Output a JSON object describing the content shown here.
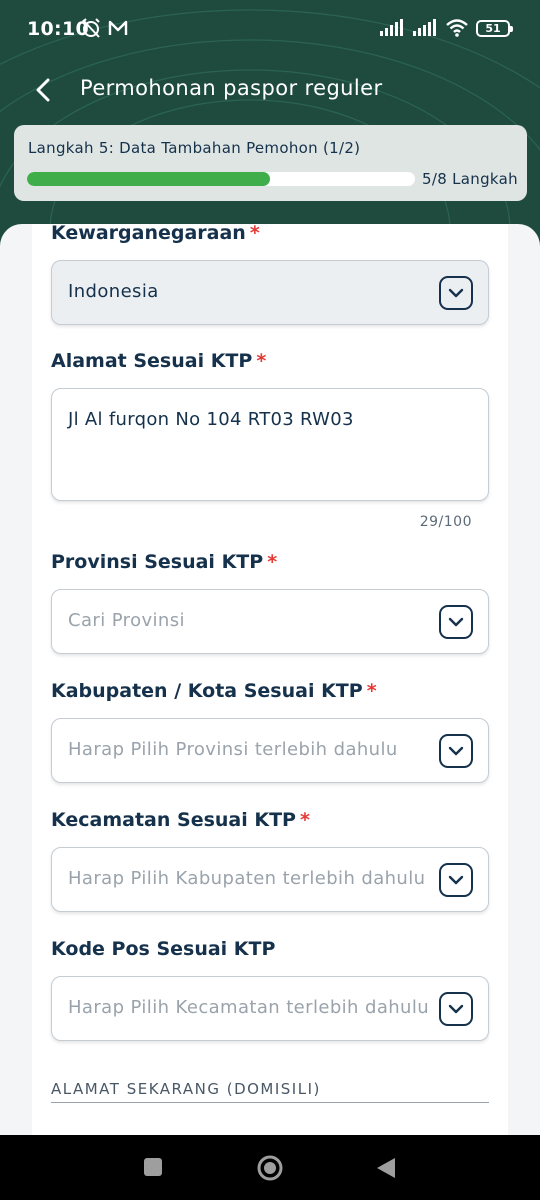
{
  "status_bar": {
    "time": "10:10",
    "battery": "51"
  },
  "app_bar": {
    "title": "Permohonan paspor reguler"
  },
  "progress": {
    "step_label": "Langkah 5: Data Tambahan Pemohon (1/2)",
    "steps_text": "5/8 Langkah",
    "fraction": 0.625
  },
  "form": {
    "kewarganegaraan": {
      "label": "Kewarganegaraan",
      "required_mark": "*",
      "value": "Indonesia"
    },
    "alamat_ktp": {
      "label": "Alamat Sesuai KTP",
      "required_mark": "*",
      "value": "Jl Al furqon No 104 RT03 RW03",
      "counter": "29/100"
    },
    "provinsi": {
      "label": "Provinsi Sesuai KTP",
      "required_mark": "*",
      "placeholder": "Cari Provinsi"
    },
    "kabupaten": {
      "label": "Kabupaten / Kota Sesuai KTP",
      "required_mark": "*",
      "placeholder": "Harap Pilih Provinsi terlebih dahulu"
    },
    "kecamatan": {
      "label": "Kecamatan Sesuai KTP",
      "required_mark": "*",
      "placeholder": "Harap Pilih Kabupaten terlebih dahulu"
    },
    "kode_pos": {
      "label": "Kode Pos Sesuai KTP",
      "placeholder": "Harap Pilih Kecamatan terlebih dahulu"
    },
    "section_domisili": "ALAMAT SEKARANG (DOMISILI)"
  },
  "colors": {
    "header": "#1f4b3f",
    "progress_fill": "#3fae4a",
    "text_primary": "#15314b",
    "required": "#e53935",
    "placeholder": "#9aa3ab"
  },
  "icons": {
    "back": "arrow-left-icon",
    "dropdown": "chevron-down-icon"
  }
}
